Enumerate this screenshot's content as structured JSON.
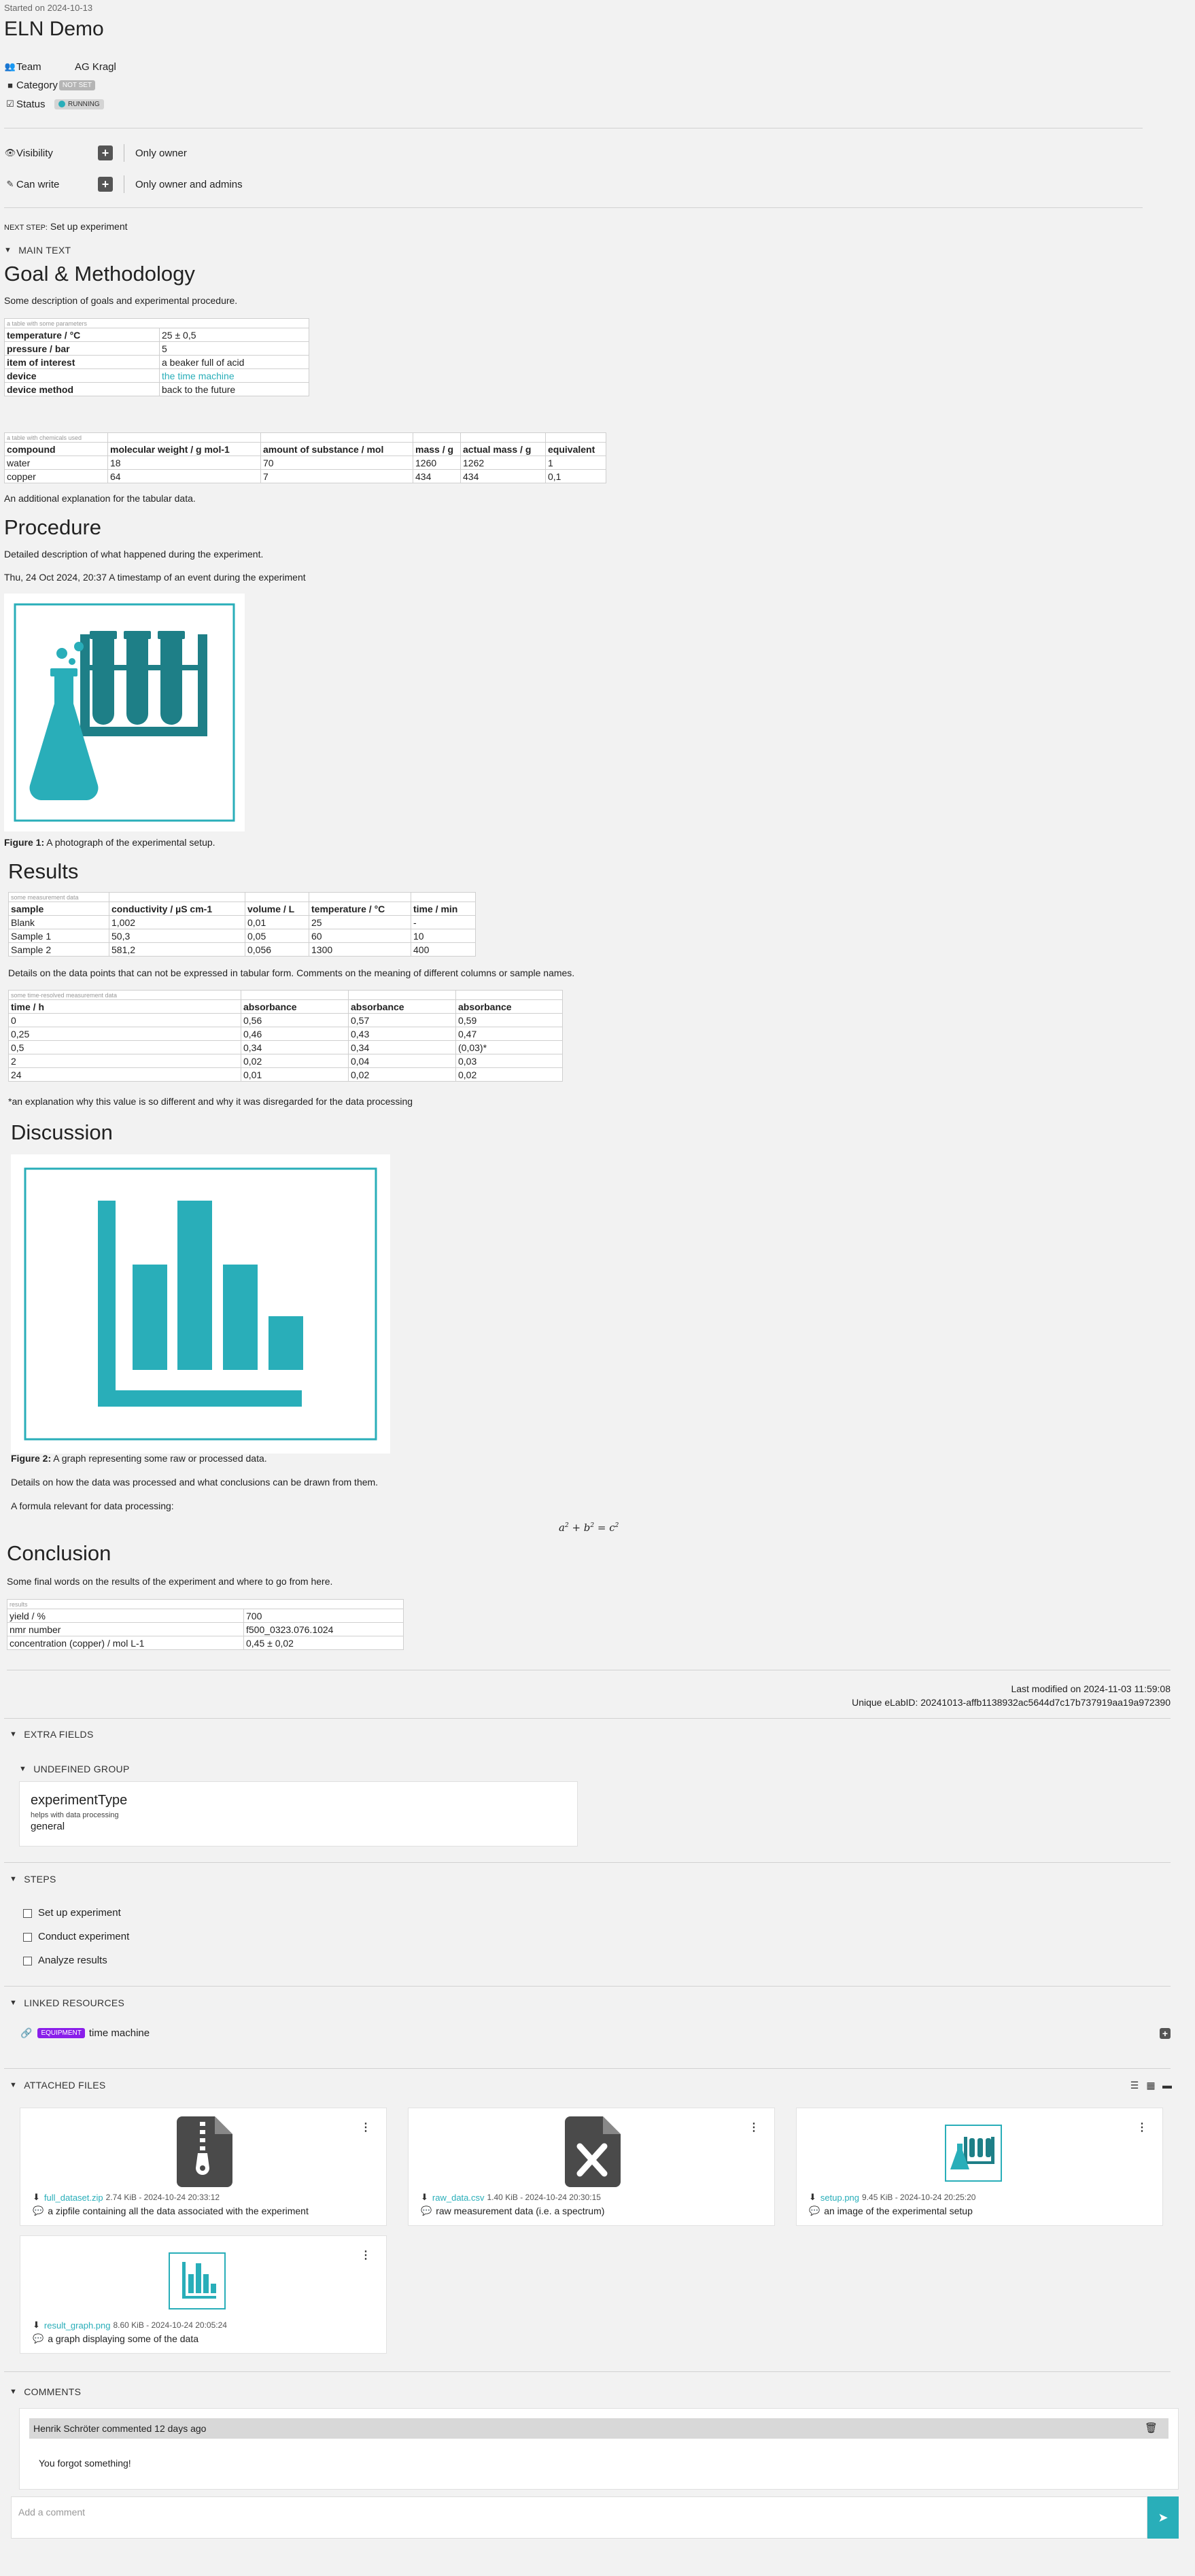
{
  "header": {
    "started": "Started on 2024-10-13",
    "title": "ELN Demo"
  },
  "meta": {
    "team_label": "Team",
    "team_value": "AG Kragl",
    "category_label": "Category",
    "category_value": "NOT SET",
    "status_label": "Status",
    "status_value": "RUNNING"
  },
  "permissions": {
    "visibility_label": "Visibility",
    "visibility_value": "Only owner",
    "canwrite_label": "Can write",
    "canwrite_value": "Only owner and admins"
  },
  "next_step": {
    "label": "NEXT STEP:",
    "value": "Set up experiment"
  },
  "main_text": {
    "section_label": "MAIN TEXT",
    "goal_title": "Goal & Methodology",
    "goal_desc": "Some description of goals and experimental procedure.",
    "params_table": {
      "caption": "a table with some parameters",
      "rows": [
        [
          "temperature / °C",
          "25 ± 0,5"
        ],
        [
          "pressure / bar",
          "5"
        ],
        [
          "item of interest",
          "a beaker full of acid"
        ],
        [
          "device",
          "the time machine"
        ],
        [
          "device method",
          "back to the future"
        ]
      ]
    },
    "chem_table": {
      "caption": "a table with chemicals used",
      "header": [
        "compound",
        "molecular weight / g mol-1",
        "amount of substance / mol",
        "mass / g",
        "actual mass / g",
        "equivalent"
      ],
      "rows": [
        [
          "water",
          "18",
          "70",
          "1260",
          "1262",
          "1"
        ],
        [
          "copper",
          "64",
          "7",
          "434",
          "434",
          "0,1"
        ]
      ]
    },
    "chem_note": "An additional explanation for the tabular data.",
    "procedure_title": "Procedure",
    "procedure_desc": "Detailed description of what happened during the experiment.",
    "timestamp": "Thu, 24 Oct 2024, 20:37",
    "timestamp_text": "A timestamp of an event during the experiment",
    "figure1_label": "Figure 1:",
    "figure1_caption": "A photograph of the experimental setup.",
    "results_title": "Results",
    "meas_table": {
      "caption": "some measurement data",
      "header": [
        "sample",
        "conductivity / µS cm-1",
        "volume / L",
        "temperature / °C",
        "time / min"
      ],
      "rows": [
        [
          "Blank",
          "1,002",
          "0,01",
          "25",
          "-"
        ],
        [
          "Sample 1",
          "50,3",
          "0,05",
          "60",
          "10"
        ],
        [
          "Sample 2",
          "581,2",
          "0,056",
          "1300",
          "400"
        ]
      ]
    },
    "meas_note": "Details on the data points that can not be expressed in tabular form. Comments on the meaning of different columns or sample names.",
    "time_table": {
      "caption": "some time-resolved measurement data",
      "header": [
        "time / h",
        "absorbance",
        "absorbance",
        "absorbance"
      ],
      "rows": [
        [
          "0",
          "0,56",
          "0,57",
          "0,59"
        ],
        [
          "0,25",
          "0,46",
          "0,43",
          "0,47"
        ],
        [
          "0,5",
          "0,34",
          "0,34",
          "(0,03)*"
        ],
        [
          "2",
          "0,02",
          "0,04",
          "0,03"
        ],
        [
          "24",
          "0,01",
          "0,02",
          "0,02"
        ]
      ]
    },
    "time_note": "*an explanation why this value is so different and why it was disregarded for the data processing",
    "discussion_title": "Discussion",
    "figure2_label": "Figure 2:",
    "figure2_caption": "A graph representing some raw or processed data.",
    "discussion_desc": "Details on how the data was processed and what conclusions can be drawn from them.",
    "formula_intro": "A formula relevant for data processing:",
    "conclusion_title": "Conclusion",
    "conclusion_desc": "Some final words on the results of the experiment and where to go from here.",
    "results_table": {
      "caption": "results",
      "rows": [
        [
          "yield / %",
          "700"
        ],
        [
          "nmr number",
          "f500_0323.076.1024"
        ],
        [
          "concentration (copper) / mol L-1",
          "0,45 ± 0,02"
        ]
      ]
    }
  },
  "footer_meta": {
    "modified": "Last modified on 2024-11-03 11:59:08",
    "elabid": "Unique eLabID: 20241013-affb1138932ac5644d7c17b737919aa19a972390"
  },
  "extra_fields": {
    "section_label": "EXTRA FIELDS",
    "group_label": "UNDEFINED GROUP",
    "field_name": "experimentType",
    "field_desc": "helps with data processing",
    "field_value": "general"
  },
  "steps": {
    "section_label": "STEPS",
    "items": [
      "Set up experiment",
      "Conduct experiment",
      "Analyze results"
    ]
  },
  "linked": {
    "section_label": "LINKED RESOURCES",
    "badge": "EQUIPMENT",
    "name": "time machine"
  },
  "files": {
    "section_label": "ATTACHED FILES",
    "items": [
      {
        "name": "full_dataset.zip",
        "info": "2.74 KiB - 2024-10-24 20:33:12",
        "comment": "a zipfile containing all the data associated with the experiment",
        "icon": "zip-file-icon"
      },
      {
        "name": "raw_data.csv",
        "info": "1.40 KiB - 2024-10-24 20:30:15",
        "comment": "raw measurement data (i.e. a spectrum)",
        "icon": "csv-file-icon"
      },
      {
        "name": "setup.png",
        "info": "9.45 KiB - 2024-10-24 20:25:20",
        "comment": "an image of the experimental setup",
        "icon": "lab-image-icon"
      },
      {
        "name": "result_graph.png",
        "info": "8.60 KiB - 2024-10-24 20:05:24",
        "comment": "a graph displaying some of the data",
        "icon": "chart-image-icon"
      }
    ]
  },
  "comments": {
    "section_label": "COMMENTS",
    "author_line": "Henrik Schröter commented 12 days ago",
    "text": "You forgot something!",
    "placeholder": "Add a comment"
  },
  "colors": {
    "accent": "#29aeb9",
    "equipment_badge": "#8a1eea",
    "dark": "#4a4a4a"
  }
}
